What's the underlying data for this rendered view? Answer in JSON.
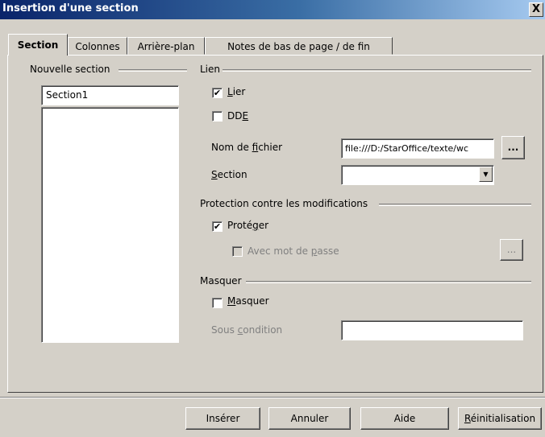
{
  "window": {
    "title": "Insertion d'une section",
    "close_glyph": "X"
  },
  "tabs": [
    {
      "label": "Section"
    },
    {
      "label": "Colonnes"
    },
    {
      "label": "Arrière-plan"
    },
    {
      "label": "Notes de bas de page / de fin"
    }
  ],
  "new_section": {
    "group_label": "Nouvelle section",
    "name_value": "Section1"
  },
  "link": {
    "group_label": "Lien",
    "lier_pre": "",
    "lier_u": "L",
    "lier_post": "ier",
    "lier_checked": true,
    "dde_pre": "DD",
    "dde_u": "E",
    "dde_post": "",
    "dde_checked": false,
    "filename_pre": "Nom de ",
    "filename_u": "f",
    "filename_post": "ichier",
    "filename_value": "file:///D:/StarOffice/texte/wc",
    "browse_label": "...",
    "section_pre": "",
    "section_u": "S",
    "section_post": "ection",
    "section_value": ""
  },
  "protection": {
    "group_label": "Protection contre les modifications",
    "protect_pre": "Proté",
    "protect_u": "g",
    "protect_post": "er",
    "protect_checked": true,
    "password_pre": "Avec mot de ",
    "password_u": "p",
    "password_post": "asse",
    "password_checked": false,
    "password_button": "..."
  },
  "hide": {
    "group_label": "Masquer",
    "hide_pre": "",
    "hide_u": "M",
    "hide_post": "asquer",
    "hide_checked": false,
    "condition_pre": "Sous ",
    "condition_u": "c",
    "condition_post": "ondition",
    "condition_value": ""
  },
  "buttons": {
    "insert": "Insérer",
    "cancel": "Annuler",
    "help": "Aide",
    "reset_u": "R",
    "reset_rest": "éinitialisation"
  }
}
